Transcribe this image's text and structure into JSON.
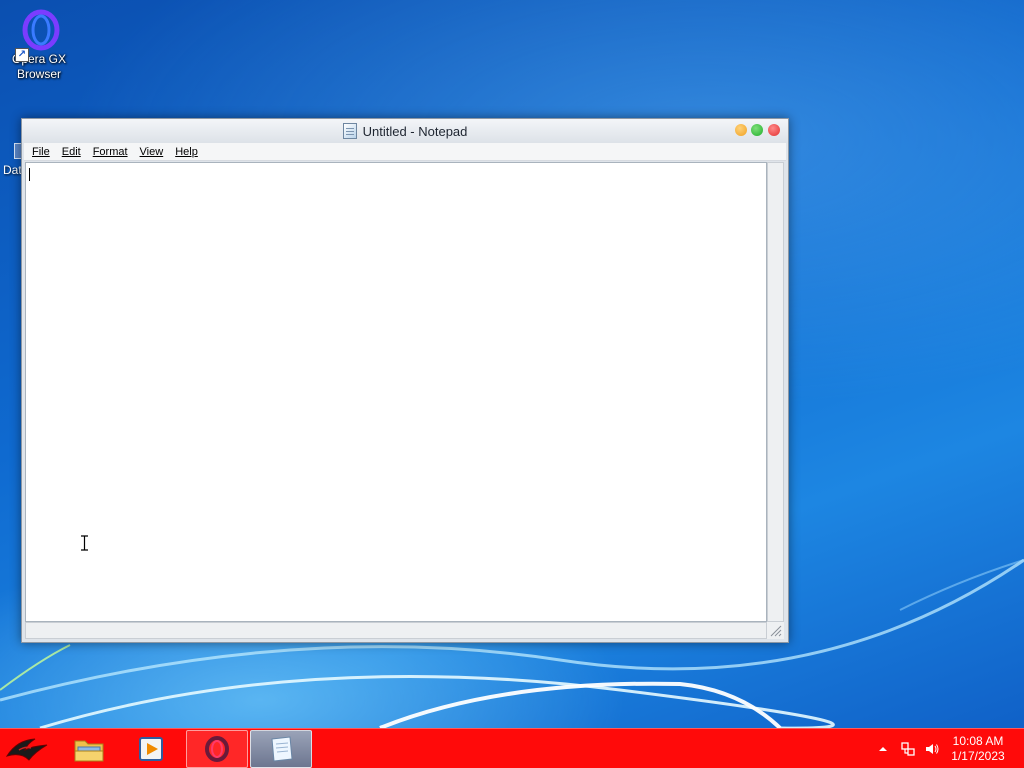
{
  "desktop": {
    "icons": [
      {
        "label_line1": "Opera GX",
        "label_line2": "Browser",
        "icon": "opera-gx-icon"
      },
      {
        "label": "Dat",
        "icon": "document-icon"
      }
    ]
  },
  "window": {
    "title": "Untitled - Notepad",
    "icon": "notepad-icon",
    "controls": [
      "minimize-button",
      "maximize-button",
      "close-button"
    ],
    "menu": [
      {
        "label": "File"
      },
      {
        "label": "Edit"
      },
      {
        "label": "Format"
      },
      {
        "label": "View"
      },
      {
        "label": "Help"
      }
    ],
    "text": ""
  },
  "taskbar": {
    "color": "#ff0a0a",
    "items": [
      {
        "name": "start-button",
        "icon": "rog-logo-icon"
      },
      {
        "name": "file-explorer",
        "icon": "folder-icon"
      },
      {
        "name": "media-player",
        "icon": "media-player-icon"
      },
      {
        "name": "opera-gx",
        "icon": "opera-gx-icon",
        "active": true
      },
      {
        "name": "notepad",
        "icon": "notepad-icon",
        "active": true
      }
    ],
    "tray": {
      "icons": [
        "show-hidden-icons-arrow",
        "network-icon",
        "volume-icon"
      ],
      "time": "10:08 AM",
      "date": "1/17/2023"
    }
  }
}
